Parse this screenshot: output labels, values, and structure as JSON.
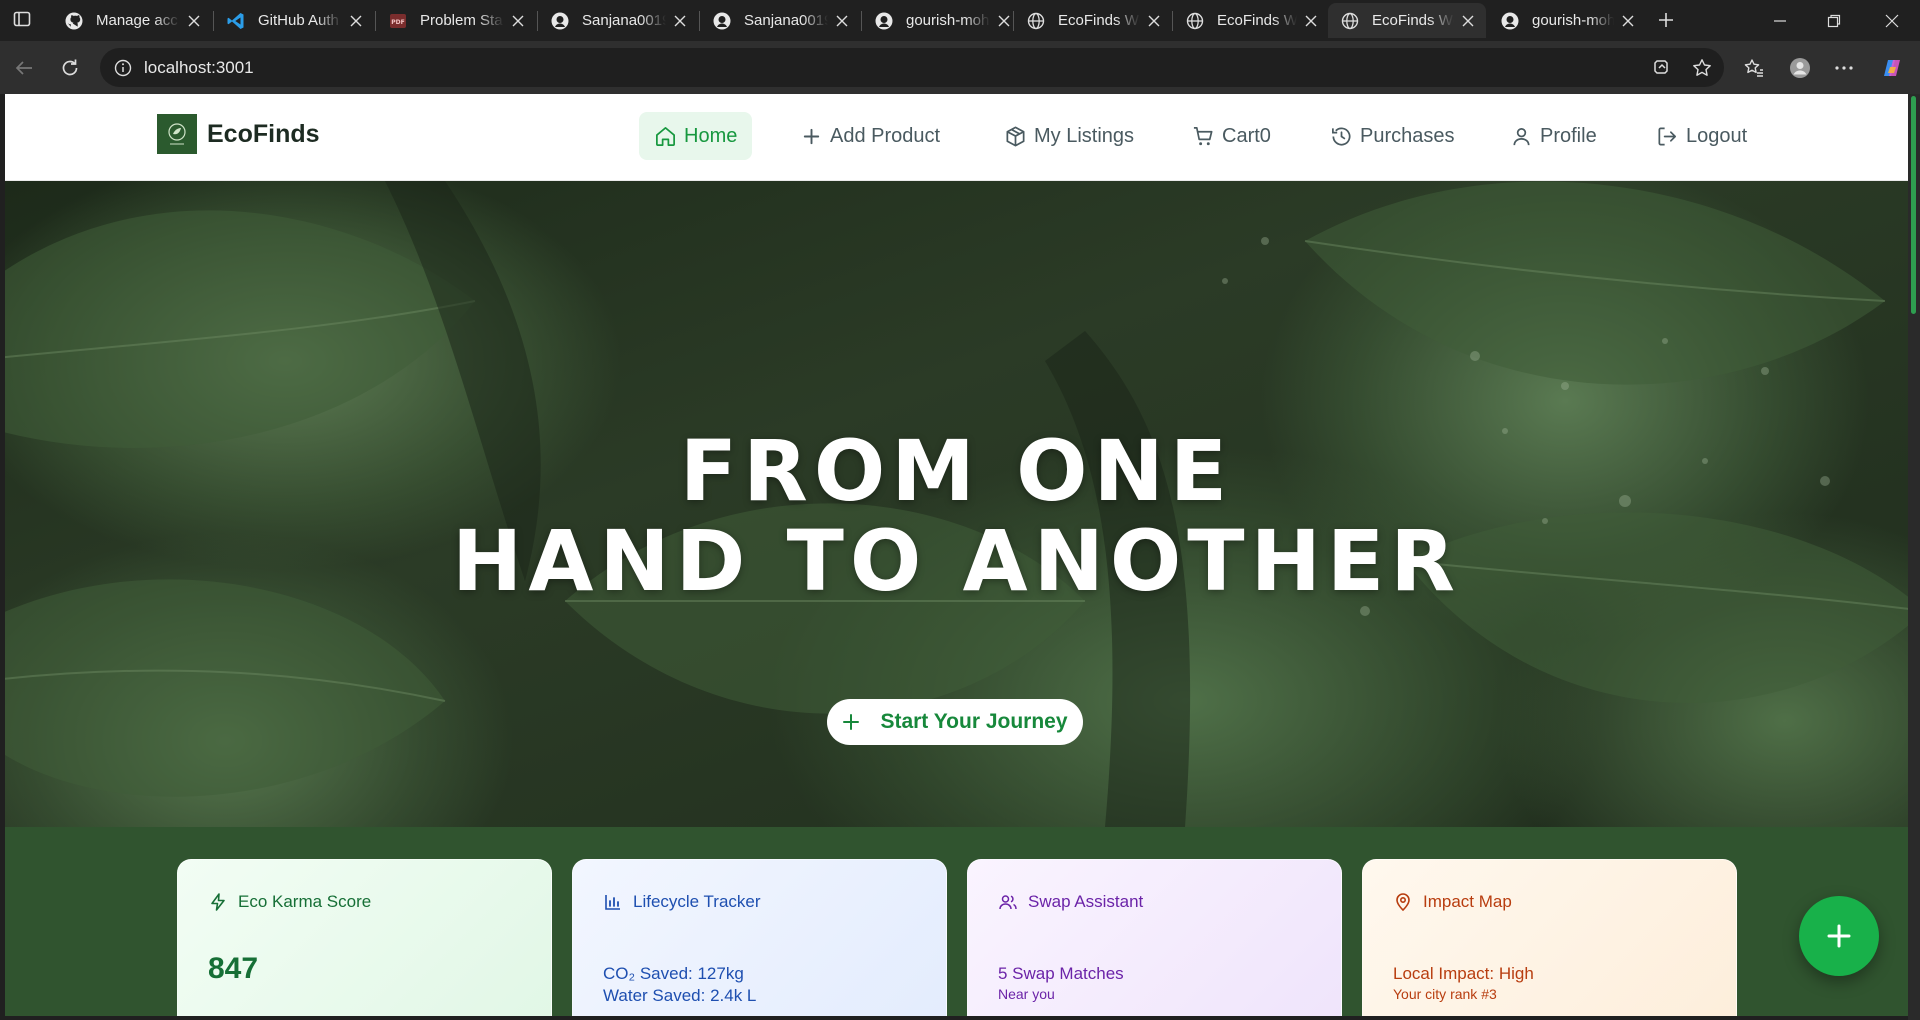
{
  "browser": {
    "tabs": [
      {
        "title": "Manage acc",
        "icon": "github-icon"
      },
      {
        "title": "GitHub Auth",
        "icon": "vscode-icon"
      },
      {
        "title": "Problem Sta",
        "icon": "pdf-icon"
      },
      {
        "title": "Sanjana0019",
        "icon": "github-icon"
      },
      {
        "title": "Sanjana0019",
        "icon": "github-icon"
      },
      {
        "title": "gourish-moh",
        "icon": "github-icon"
      },
      {
        "title": "EcoFinds We",
        "icon": "globe-icon"
      },
      {
        "title": "EcoFinds We",
        "icon": "globe-icon"
      },
      {
        "title": "EcoFinds We",
        "icon": "globe-icon",
        "active": true
      },
      {
        "title": "gourish-moh",
        "icon": "github-icon"
      }
    ],
    "address": "localhost:3001"
  },
  "navbar": {
    "brand": "EcoFinds",
    "items": [
      {
        "label": "Home",
        "icon": "home-icon",
        "active": true
      },
      {
        "label": "Add Product",
        "icon": "plus-icon"
      },
      {
        "label": "My Listings",
        "icon": "box-icon"
      },
      {
        "label": "Cart0",
        "icon": "cart-icon"
      },
      {
        "label": "Purchases",
        "icon": "history-icon"
      },
      {
        "label": "Profile",
        "icon": "user-icon"
      },
      {
        "label": "Logout",
        "icon": "logout-icon"
      }
    ]
  },
  "hero": {
    "title_line1": "FROM ONE",
    "title_line2": "HAND TO ANOTHER",
    "cta": "Start Your Journey"
  },
  "features": [
    {
      "title": "Eco Karma Score",
      "icon": "zap-icon",
      "value": "847"
    },
    {
      "title": "Lifecycle Tracker",
      "icon": "bar-chart-icon",
      "line1": "CO₂ Saved: 127kg",
      "line2": "Water Saved: 2.4k L"
    },
    {
      "title": "Swap Assistant",
      "icon": "users-icon",
      "line1": "5 Swap Matches",
      "sub": "Near you"
    },
    {
      "title": "Impact Map",
      "icon": "map-pin-icon",
      "line1": "Local Impact: High",
      "sub": "Your city rank #3"
    }
  ],
  "colors": {
    "primary": "#17983f",
    "feature_band": "#30542f",
    "fab": "#18b14a"
  }
}
